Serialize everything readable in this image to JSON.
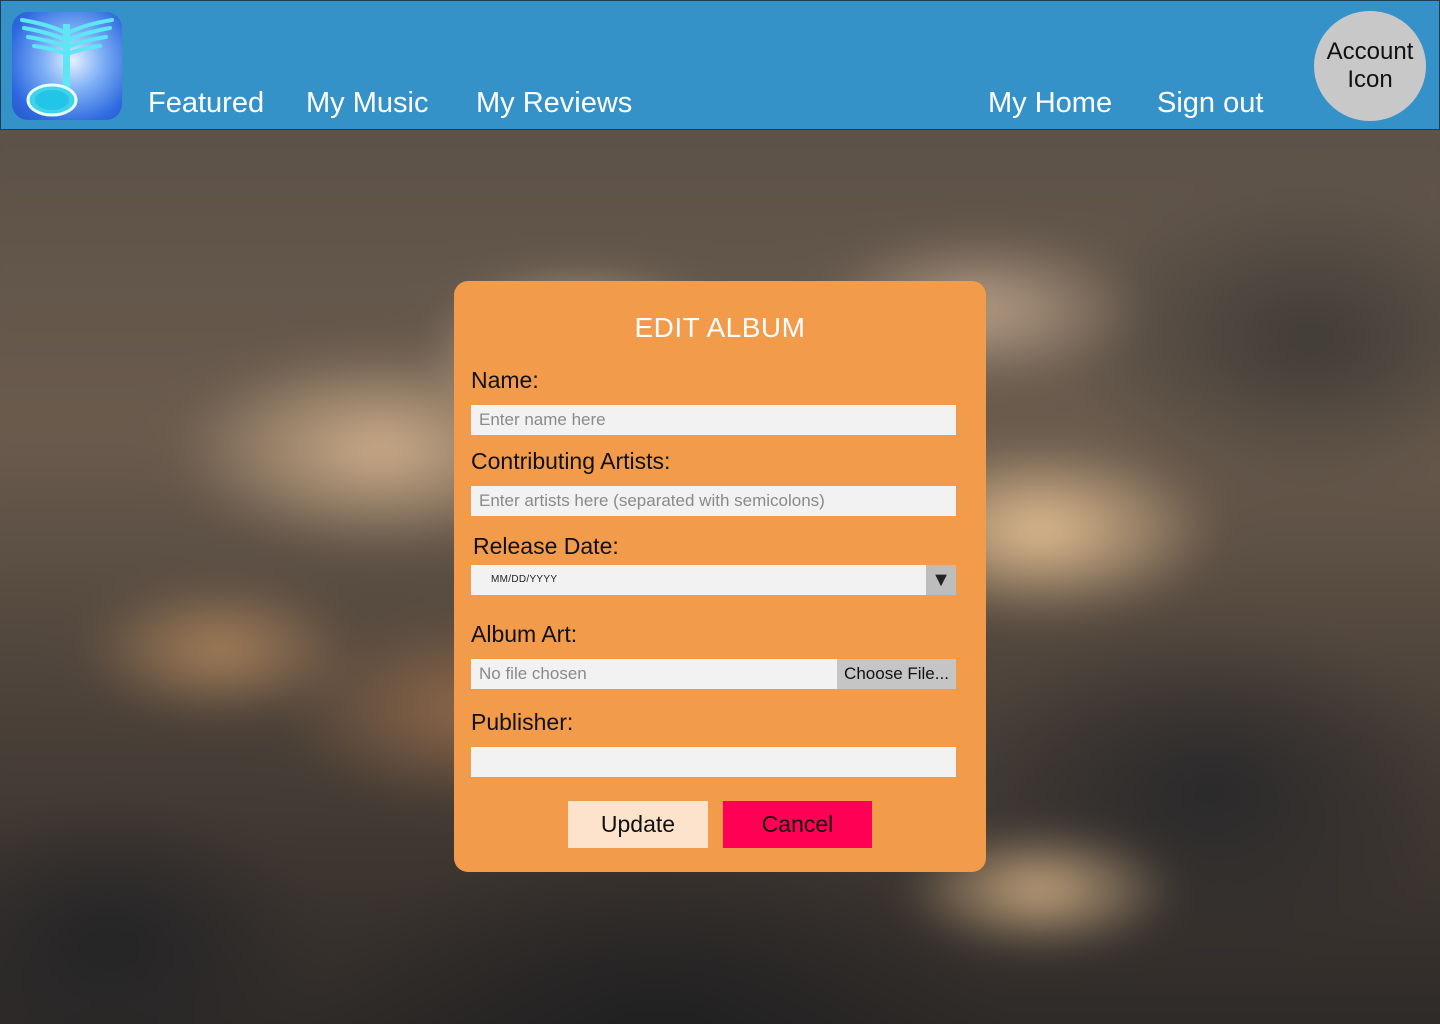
{
  "header": {
    "logo_icon": "music-note-wings-logo-icon",
    "nav_left": [
      "Featured",
      "My Music",
      "My Reviews"
    ],
    "nav_right": [
      "My Home",
      "Sign out"
    ],
    "account_label": "Account Icon",
    "colors": {
      "bar": "#3592c8",
      "account": "#c8c8c8"
    }
  },
  "dialog": {
    "title": "EDIT ALBUM",
    "name_label": "Name:",
    "name_placeholder": "Enter name here",
    "artists_label": "Contributing Artists:",
    "artists_placeholder": "Enter artists here (separated with semicolons)",
    "release_label": "Release Date:",
    "release_value": "MM/DD/YYYY",
    "release_icon": "dropdown-triangle-icon",
    "art_label": "Album Art:",
    "art_status": "No file chosen",
    "art_button": "Choose File...",
    "publisher_label": "Publisher:",
    "publisher_value": "",
    "update_label": "Update",
    "cancel_label": "Cancel",
    "colors": {
      "panel": "#f29b4b",
      "update": "#fde3cb",
      "cancel": "#ff0055",
      "title": "#ffffff"
    }
  }
}
